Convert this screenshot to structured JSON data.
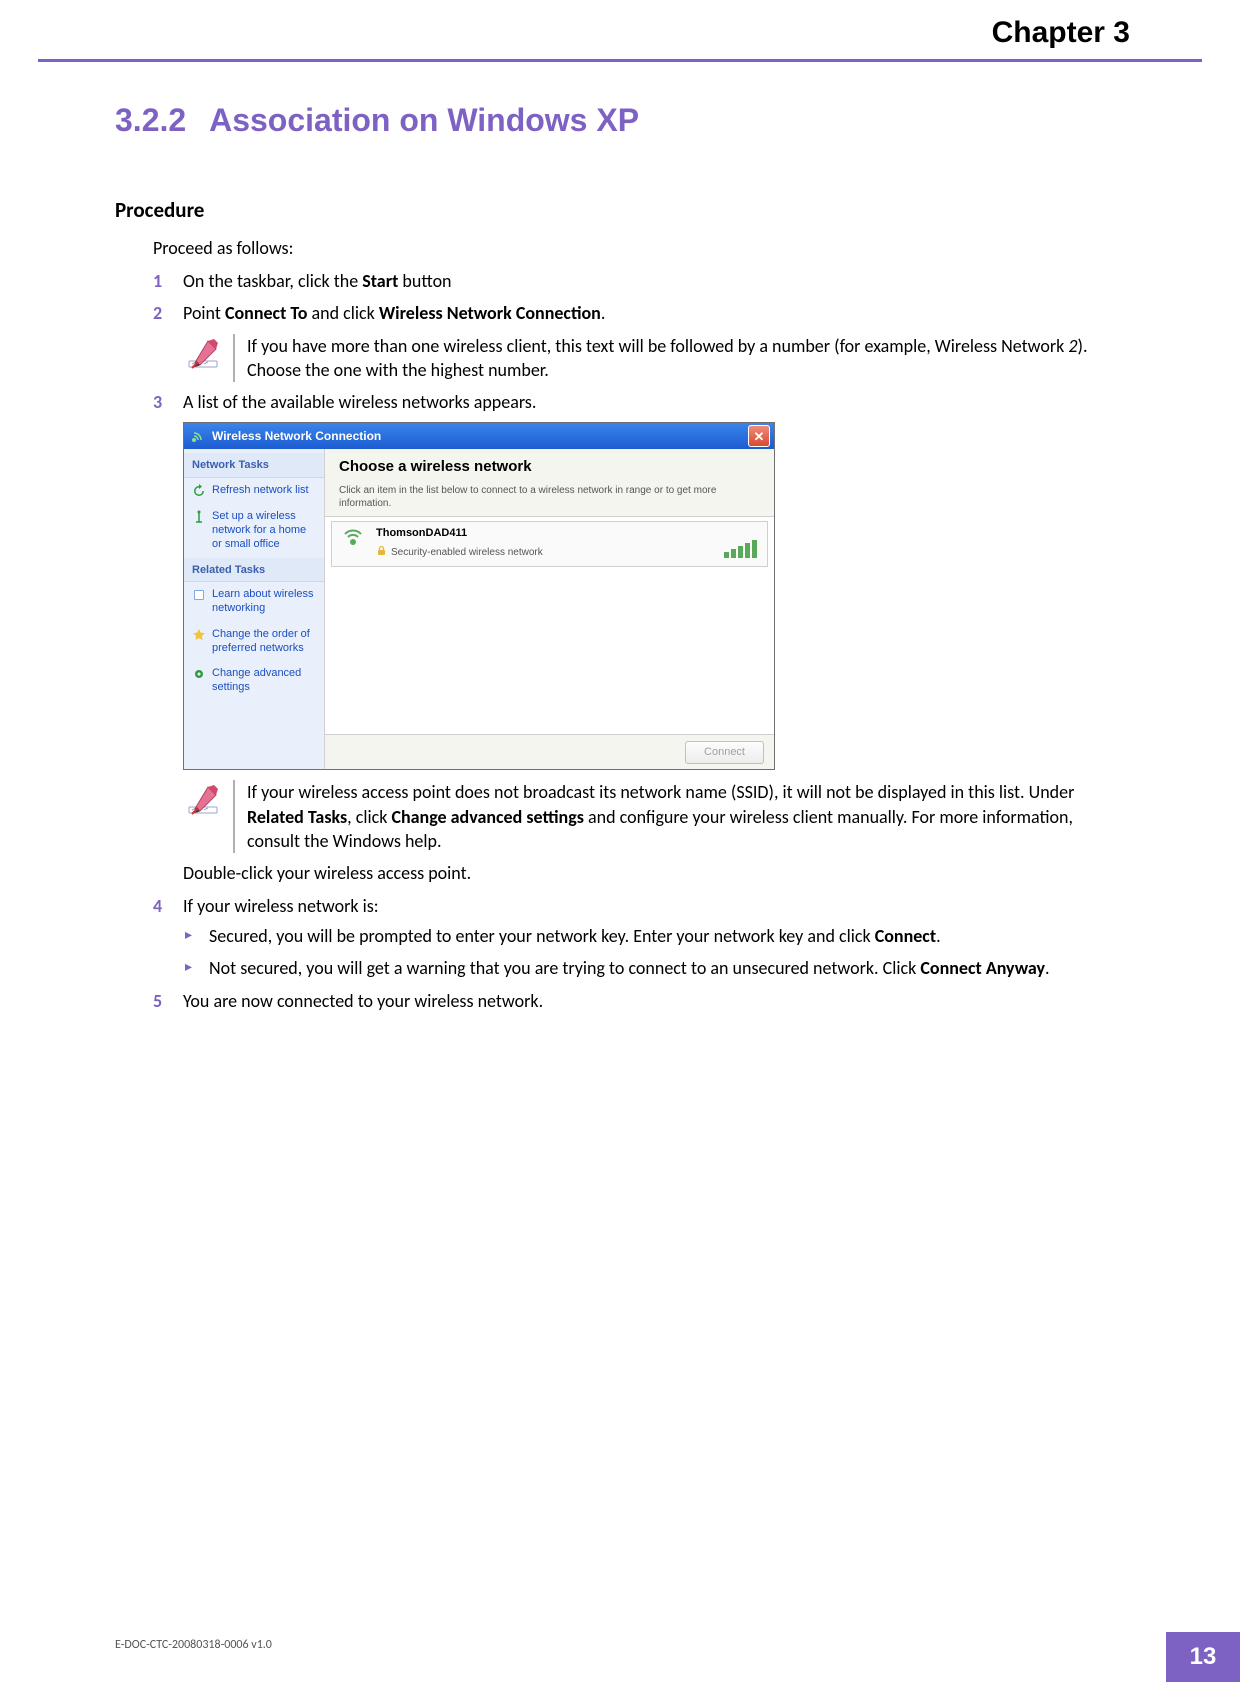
{
  "header": {
    "chapter": "Chapter 3"
  },
  "section": {
    "number": "3.2.2",
    "title": "Association on Windows XP"
  },
  "procedure": {
    "heading": "Procedure",
    "intro": "Proceed as follows:",
    "steps": [
      {
        "n": "1",
        "parts": [
          "On the taskbar, click the ",
          "Start",
          " button"
        ]
      },
      {
        "n": "2",
        "parts": [
          "Point ",
          "Connect To",
          " and click ",
          "Wireless Network Connection",
          "."
        ],
        "note": {
          "parts": [
            "If you have more than one wireless client, this text will be followed by a number (for example, Wireless Network ",
            "2",
            "). Choose the one with the highest number."
          ]
        }
      },
      {
        "n": "3",
        "text": "A list of the available wireless networks appears.",
        "screenshot": true,
        "note2": {
          "parts": [
            "If your wireless access point does not broadcast its network name (SSID), it will not be displayed in this list. Under ",
            "Related Tasks",
            ", click ",
            "Change advanced settings",
            " and configure your wireless client manually. For more information, consult the Windows help."
          ]
        },
        "after": "Double-click your wireless access point."
      },
      {
        "n": "4",
        "text": "If your wireless network is:",
        "bullets": [
          {
            "parts": [
              "Secured, you will be prompted to enter your network key. Enter your network key and click ",
              "Connect",
              "."
            ]
          },
          {
            "parts": [
              "Not secured, you will get a warning that you are trying to connect to an unsecured network. Click ",
              "Connect Anyway",
              "."
            ]
          }
        ]
      },
      {
        "n": "5",
        "text": "You are now connected to your wireless network."
      }
    ]
  },
  "screenshot": {
    "title": "Wireless Network Connection",
    "sidebar": {
      "group1": "Network Tasks",
      "t1": "Refresh network list",
      "t2": "Set up a wireless network for a home or small office",
      "group2": "Related Tasks",
      "t3": "Learn about wireless networking",
      "t4": "Change the order of preferred networks",
      "t5": "Change advanced settings"
    },
    "main": {
      "heading": "Choose a wireless network",
      "sub": "Click an item in the list below to connect to a wireless network in range or to get more information.",
      "net_name": "ThomsonDAD411",
      "net_sec": "Security-enabled wireless network",
      "connect": "Connect"
    }
  },
  "footer": {
    "docid": "E-DOC-CTC-20080318-0006 v1.0",
    "page": "13"
  }
}
